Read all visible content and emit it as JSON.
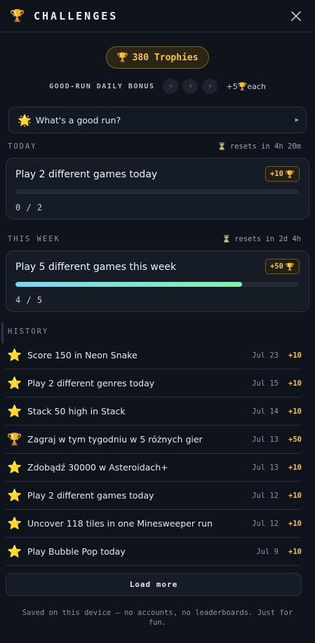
{
  "header": {
    "title": "CHALLENGES",
    "icon": "trophy-icon",
    "close_icon": "close-icon"
  },
  "trophies": {
    "label": "380 Trophies"
  },
  "bonus": {
    "label": "GOOD-RUN DAILY BONUS",
    "slots": 3,
    "reward_amount": "+5",
    "reward_suffix": "each"
  },
  "good_run": {
    "label": "What's a good run?"
  },
  "today": {
    "section_label": "TODAY",
    "reset_label": "resets in 4h 20m",
    "challenge": {
      "title": "Play 2 different games today",
      "reward": "+10",
      "progress_text": "0 / 2",
      "progress": 0.0
    }
  },
  "week": {
    "section_label": "THIS WEEK",
    "reset_label": "resets in 2d 4h",
    "challenge": {
      "title": "Play 5 different games this week",
      "reward": "+50",
      "progress_text": "4 / 5",
      "progress": 0.8
    }
  },
  "history": {
    "label": "HISTORY",
    "items": [
      {
        "icon": "star",
        "title": "Score 150 in Neon Snake",
        "date": "Jul 23",
        "points": "+10"
      },
      {
        "icon": "star",
        "title": "Play 2 different genres today",
        "date": "Jul 15",
        "points": "+10"
      },
      {
        "icon": "star",
        "title": "Stack 50 high in Stack",
        "date": "Jul 14",
        "points": "+10"
      },
      {
        "icon": "trophy",
        "title": "Zagraj w tym tygodniu w 5 różnych gier",
        "date": "Jul 13",
        "points": "+50"
      },
      {
        "icon": "star",
        "title": "Zdobądź 30000 w Asteroidach+",
        "date": "Jul 13",
        "points": "+10"
      },
      {
        "icon": "star",
        "title": "Play 2 different games today",
        "date": "Jul 12",
        "points": "+10"
      },
      {
        "icon": "star",
        "title": "Uncover 118 tiles in one Minesweeper run",
        "date": "Jul 12",
        "points": "+10"
      },
      {
        "icon": "star",
        "title": "Play Bubble Pop today",
        "date": "Jul 9",
        "points": "+10"
      }
    ]
  },
  "load_more": {
    "label": "Load more"
  },
  "footer": {
    "text": "Saved on this device — no accounts, no leaderboards. Just for fun."
  }
}
